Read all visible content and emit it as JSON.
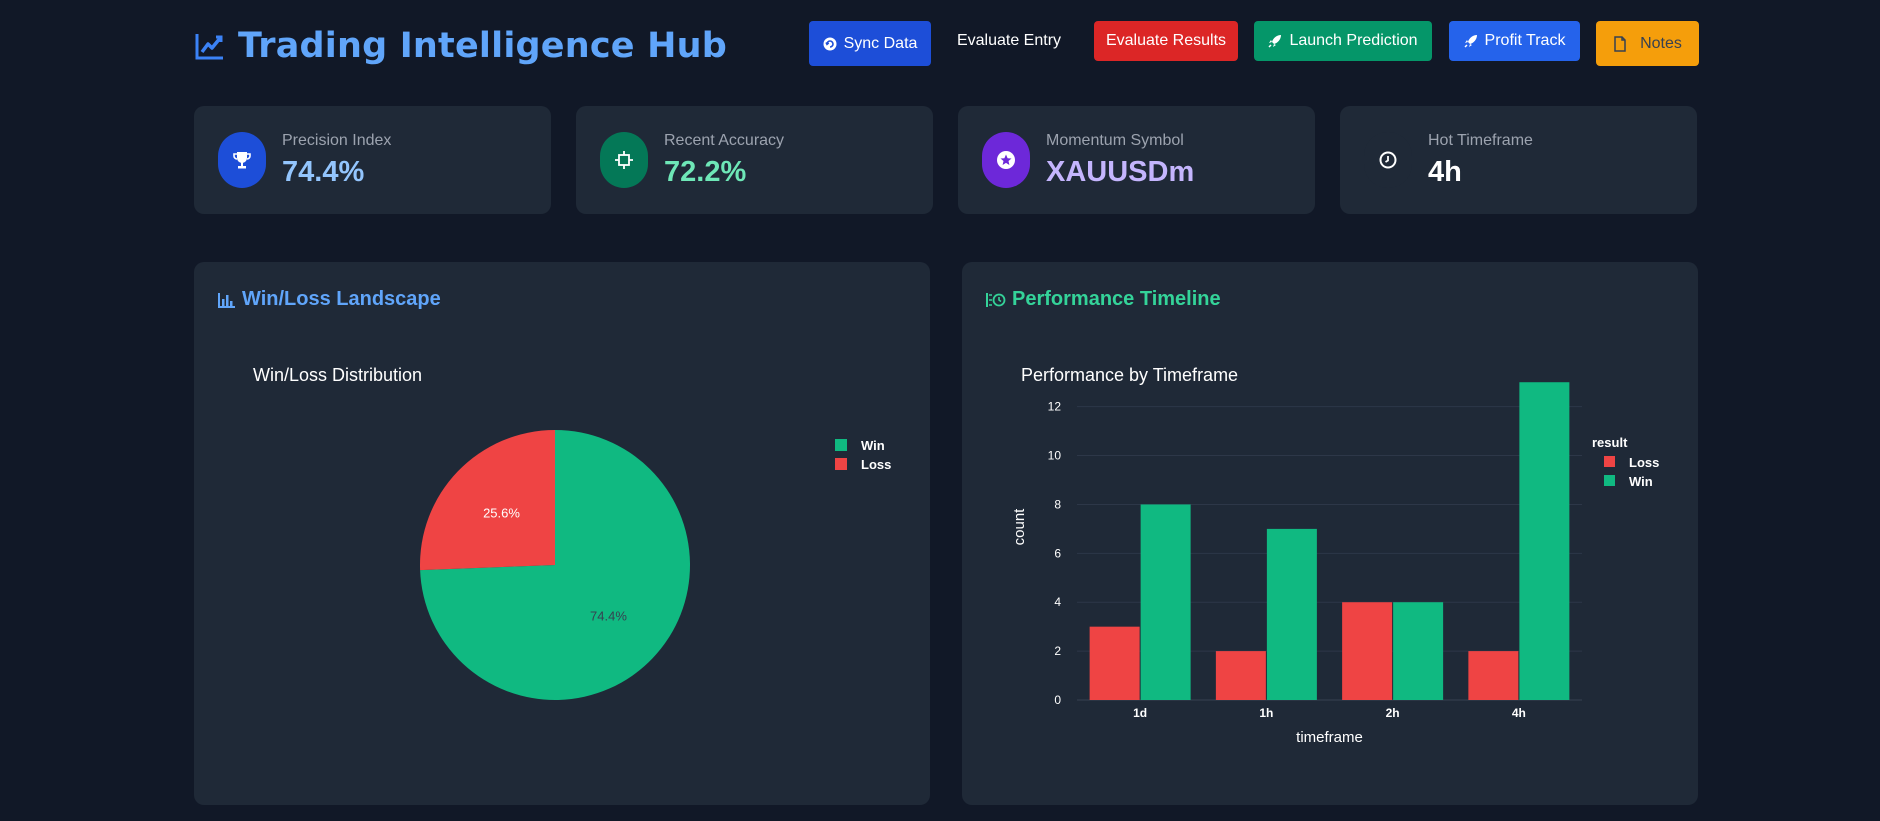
{
  "header": {
    "title": "Trading Intelligence Hub",
    "buttons": {
      "sync": "Sync Data",
      "entry": "Evaluate Entry",
      "results": "Evaluate Results",
      "launch": "Launch Prediction",
      "profit": "Profit Track",
      "notes": "Notes"
    }
  },
  "stats": [
    {
      "label": "Precision Index",
      "value": "74.4%",
      "icon": "trophy-icon",
      "color": "#93c5fd",
      "icon_bg": "#1d4ed8"
    },
    {
      "label": "Recent Accuracy",
      "value": "72.2%",
      "icon": "crosshair-icon",
      "color": "#6ee7b7",
      "icon_bg": "#047857"
    },
    {
      "label": "Momentum Symbol",
      "value": "XAUUSDm",
      "icon": "star-icon",
      "color": "#c4b5fd",
      "icon_bg": "#6d28d9"
    },
    {
      "label": "Hot Timeframe",
      "value": "4h",
      "icon": "clock-icon",
      "color": "#ffffff",
      "icon_bg": "#1f2937"
    }
  ],
  "panels": {
    "left_title": "Win/Loss Landscape",
    "right_title": "Performance Timeline"
  },
  "colors": {
    "win": "#10b981",
    "loss": "#ef4444",
    "accent": "#60a5fa"
  },
  "chart_data": [
    {
      "type": "pie",
      "title": "Win/Loss Distribution",
      "labels": [
        "Win",
        "Loss"
      ],
      "values": [
        74.4,
        25.6
      ],
      "slice_labels": [
        "74.4%",
        "25.6%"
      ],
      "colors": [
        "#10b981",
        "#ef4444"
      ],
      "legend": "right"
    },
    {
      "type": "bar",
      "title": "Performance by Timeframe",
      "categories": [
        "1d",
        "1h",
        "2h",
        "4h"
      ],
      "series": [
        {
          "name": "Loss",
          "values": [
            3,
            2,
            4,
            2
          ],
          "color": "#ef4444"
        },
        {
          "name": "Win",
          "values": [
            8,
            7,
            4,
            13
          ],
          "color": "#10b981"
        }
      ],
      "xlabel": "timeframe",
      "ylabel": "count",
      "legend_title": "result",
      "yticks": [
        0,
        2,
        4,
        6,
        8,
        10,
        12
      ],
      "ylim": [
        0,
        13.5
      ],
      "grid": true,
      "legend": "top-right"
    }
  ]
}
